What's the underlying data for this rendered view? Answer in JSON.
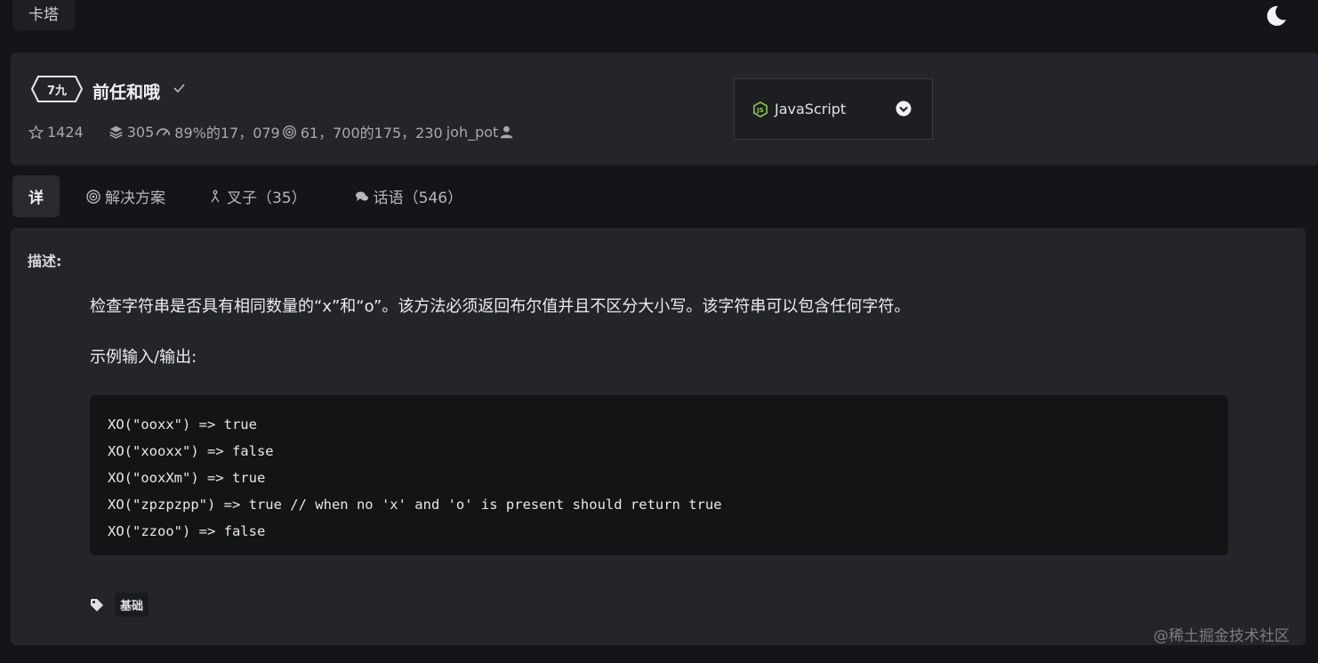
{
  "app": {
    "brand": "卡塔"
  },
  "kata": {
    "rank": "7九",
    "title": "前任和哦",
    "stats": {
      "stars": "1424",
      "collections": "305",
      "satisfaction": "89%的17，079",
      "completed": "61，700的175，230",
      "author": "joh_pot"
    }
  },
  "language_select": {
    "selected": "JavaScript"
  },
  "tabs": [
    {
      "label": "详"
    },
    {
      "label": "解决方案"
    },
    {
      "label": "叉子（35）"
    },
    {
      "label": "话语（546）"
    }
  ],
  "description": {
    "label": "描述:",
    "text": "检查字符串是否具有相同数量的“x”和“o”。该方法必须返回布尔值并且不区分大小写。该字符串可以包含任何字符。",
    "example_label": "示例输入/输出:",
    "code": [
      "XO(\"ooxx\") => true",
      "XO(\"xooxx\") => false",
      "XO(\"ooxXm\") => true",
      "XO(\"zpzpzpp\") => true // when no 'x' and 'o' is present should return true",
      "XO(\"zzoo\") => false"
    ]
  },
  "tags": [
    "基础"
  ],
  "watermark": "@稀土掘金技术社区",
  "colors": {
    "background": "#141518",
    "card": "#24252a",
    "code_bg": "#131416",
    "js_icon": "#8cc84b"
  },
  "icons": [
    "moon-icon",
    "check-icon",
    "star-icon",
    "stack-icon",
    "gauge-icon",
    "target-icon",
    "user-icon",
    "js-icon",
    "chevron-down-icon",
    "fork-icon",
    "comments-icon",
    "tag-icon"
  ]
}
